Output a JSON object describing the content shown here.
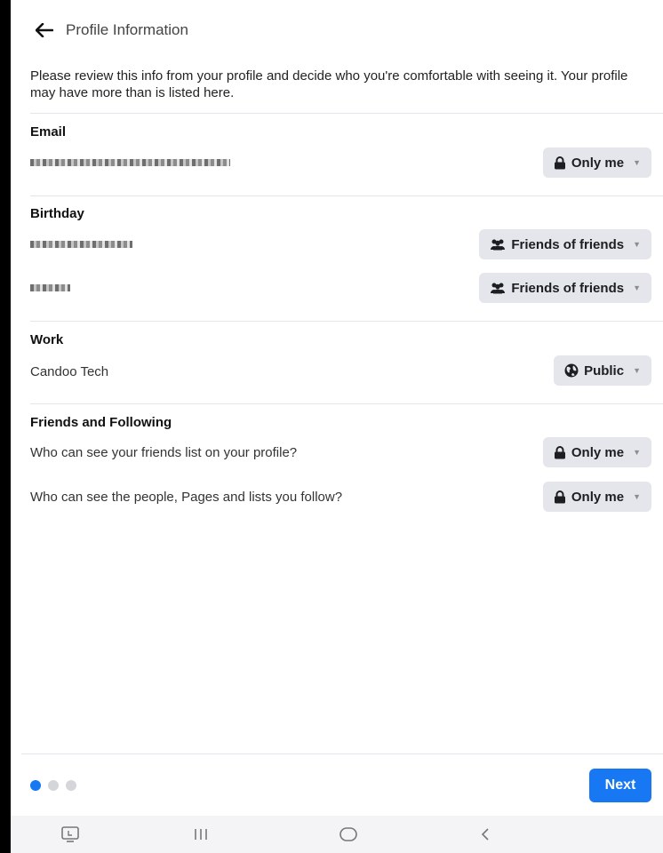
{
  "header": {
    "title": "Profile Information",
    "back_icon": "arrow-left-icon"
  },
  "intro": "Please review this info from your profile and decide who you're comfortable with seeing it. Your profile may have more than is listed here.",
  "sections": {
    "email": {
      "title": "Email",
      "audience": "Only me"
    },
    "birthday": {
      "title": "Birthday",
      "audience_1": "Friends of friends",
      "audience_2": "Friends of friends"
    },
    "work": {
      "title": "Work",
      "value": "Candoo Tech",
      "audience": "Public"
    },
    "friends": {
      "title": "Friends and Following",
      "q1": "Who can see your friends list on your profile?",
      "q1_audience": "Only me",
      "q2": "Who can see the people, Pages and lists you follow?",
      "q2_audience": "Only me"
    }
  },
  "footer": {
    "next_label": "Next",
    "pages": 3,
    "current_page": 1
  },
  "colors": {
    "accent": "#1877f2",
    "button_bg": "#e4e6eb",
    "divider": "#e4e6eb"
  },
  "icons": {
    "only_me": "lock-icon",
    "friends_of_friends": "people-icon",
    "public": "globe-icon",
    "caret": "caret-down-icon"
  },
  "navbar": [
    "recent-apps-icon",
    "home-icon",
    "back-nav-icon",
    "screenshot-icon"
  ]
}
